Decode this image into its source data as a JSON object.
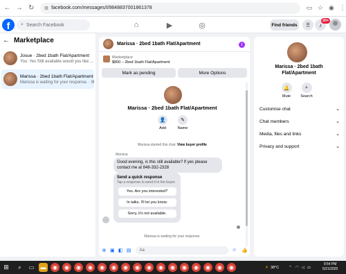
{
  "browser": {
    "url": "facebook.com/messages/t/9848837001861378"
  },
  "fb": {
    "logo_letter": "f",
    "search_placeholder": "Search Facebook",
    "find_friends": "Find friends",
    "notif_count": "20+"
  },
  "left": {
    "title": "Marketplace",
    "conversations": [
      {
        "title": "Josue · 2bed 1bath Flat/Apartment",
        "subtitle": "You: Yes Still available would you like ... · 1m"
      },
      {
        "title": "Marissa · 2bed 1bath Flat/Apartment",
        "subtitle": "Marissa is waiting for your response. · 9h"
      }
    ]
  },
  "chat": {
    "header_title": "Marissa · 2bed 1bath Flat/Apartment",
    "listing_label": "Marketplace",
    "listing_detail": "$800 – 2bed 1bath Flat/Apartment",
    "mark_pending": "Mark as pending",
    "more_options": "More Options",
    "profile_title": "Marissa · 2bed 1bath Flat/Apartment",
    "add_label": "Add",
    "name_label": "Name",
    "started_text": "Marissa started this chat.",
    "view_profile": "View buyer profile",
    "sender": "Marissa",
    "message": "Good evening, is this still available? If yes please contact me at 848-332-2328",
    "quick_title": "Send a quick response",
    "quick_sub": "Tap a response to send it to the buyer.",
    "quick_options": [
      "Yes. Are you interested?",
      "In talks. I'll let you know.",
      "Sorry, it's not available."
    ],
    "waiting": "Marissa is waiting for your response.",
    "composer_placeholder": "Aa"
  },
  "right": {
    "title": "Marissa · 2bed 1bath Flat/Apartment",
    "mute": "Mute",
    "search": "Search",
    "sections": [
      "Customise chat",
      "Chat members",
      "Media, files and links",
      "Privacy and support"
    ]
  },
  "taskbar": {
    "weather": "38°C",
    "time": "9:54 PM",
    "date": "5/21/2025"
  },
  "colors": {
    "brand": "#0866ff",
    "active_row": "#e7f3ff",
    "info_purple": "#a033ff"
  }
}
